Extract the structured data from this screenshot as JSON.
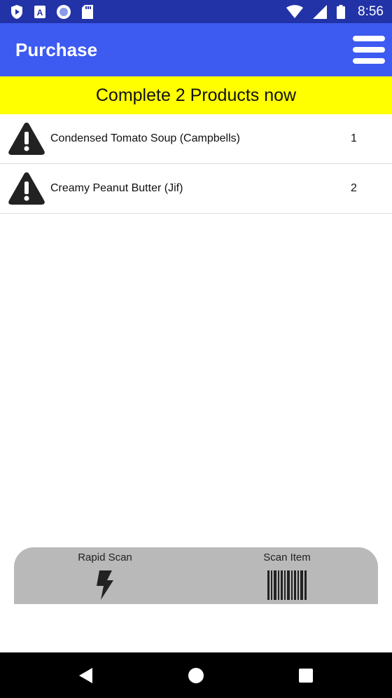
{
  "status_bar": {
    "time": "8:56",
    "icons": [
      "play-protect-icon",
      "a-text-icon",
      "circle-record-icon",
      "sd-card-icon",
      "wifi-icon",
      "signal-icon",
      "battery-icon"
    ]
  },
  "app_bar": {
    "title": "Purchase"
  },
  "banner": {
    "text": "Complete 2 Products now",
    "color": "#ffff00"
  },
  "products": [
    {
      "name": "Condensed Tomato Soup (Campbells)",
      "qty": "1",
      "icon": "warning-icon"
    },
    {
      "name": "Creamy Peanut Butter (Jif)",
      "qty": "2",
      "icon": "warning-icon"
    }
  ],
  "scan_bar": {
    "rapid_scan_label": "Rapid Scan",
    "scan_item_label": "Scan Item"
  },
  "colors": {
    "status_bar": "#2233a8",
    "app_bar": "#3d5af1",
    "scan_bar": "#b9b9b9"
  }
}
